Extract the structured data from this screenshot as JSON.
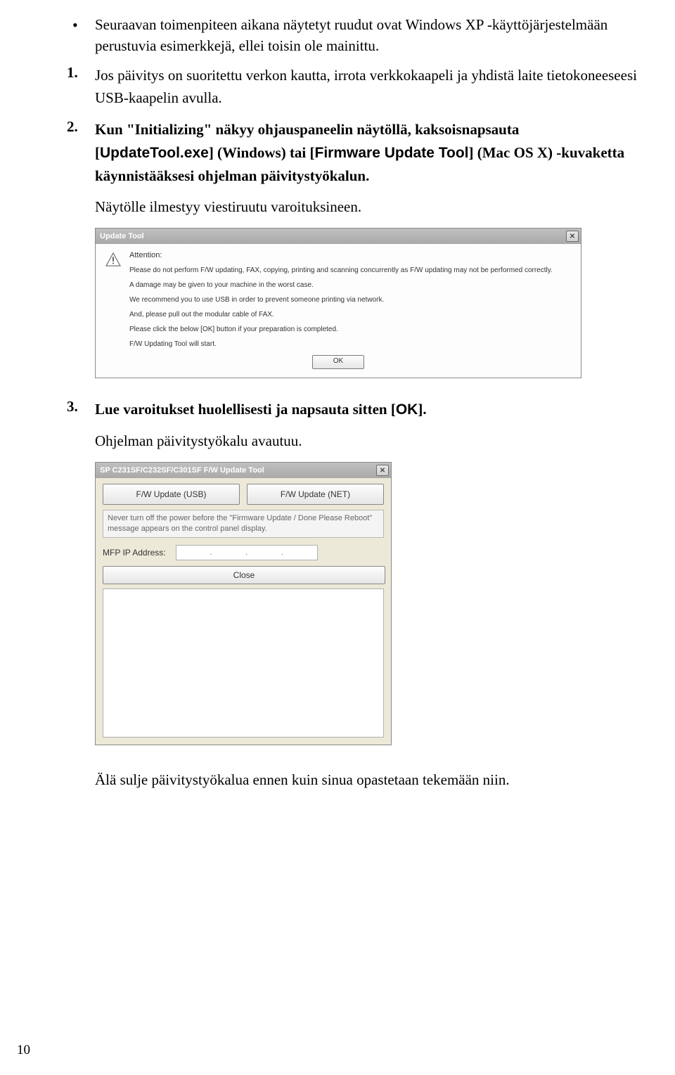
{
  "bullet": {
    "text": "Seuraavan toimenpiteen aikana näytetyt ruudut ovat Windows XP -käyttöjärjestelmään perustuvia esimerkkejä, ellei toisin ole mainittu."
  },
  "step1": {
    "marker": "1.",
    "text": "Jos päivitys on suoritettu verkon kautta, irrota verkkokaapeli ja yhdistä laite tietokoneeseesi USB-kaapelin avulla."
  },
  "step2": {
    "marker": "2.",
    "pre": "Kun \"Initializing\" näkyy ohjauspaneelin näytöllä, kaksoisnapsauta [",
    "tool1": "UpdateTool.exe",
    "mid1": "] (Windows) tai [",
    "tool2": "Firmware Update Tool",
    "mid2": "] (Mac OS X) -kuvaketta käynnistääksesi ohjelman päivitystyökalun.",
    "follow": "Näytölle ilmestyy viestiruutu varoituksineen."
  },
  "dialog1": {
    "title": "Update Tool",
    "attention": "Attention:",
    "lines": [
      "Please do not perform F/W updating, FAX, copying, printing and scanning concurrently as F/W updating may not be performed correctly.",
      "A damage may be given to your machine in the worst case.",
      "We recommend you to use USB in order to prevent someone printing via network.",
      "And, please pull out the modular cable of FAX.",
      "Please click the below [OK] button if your preparation is completed.",
      "F/W Updating Tool will start."
    ],
    "ok": "OK"
  },
  "step3": {
    "marker": "3.",
    "pre": "Lue varoitukset huolellisesti ja napsauta sitten [",
    "btn": "OK",
    "post": "].",
    "follow": "Ohjelman päivitystyökalu avautuu."
  },
  "dialog2": {
    "title": "SP C231SF/C232SF/C301SF F/W Update Tool",
    "btnUsb": "F/W Update (USB)",
    "btnNet": "F/W Update (NET)",
    "msg": "Never turn off the power before the \"Firmware Update / Done Please Reboot\" message appears on the control panel display.",
    "ipLabel": "MFP IP Address:",
    "ipDots": ". . .",
    "close": "Close"
  },
  "closing": "Älä sulje päivitystyökalua ennen kuin sinua opastetaan tekemään niin.",
  "pageNumber": "10"
}
